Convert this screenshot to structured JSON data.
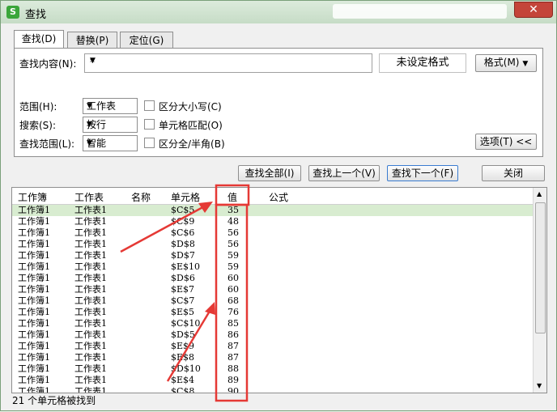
{
  "window": {
    "title": "查找",
    "app_icon": "S",
    "close_glyph": "✕"
  },
  "tabs": [
    "查找(D)",
    "替换(P)",
    "定位(G)"
  ],
  "find": {
    "label": "查找内容(N):",
    "value": "*",
    "format_state": "未设定格式",
    "format_button": "格式(M)"
  },
  "options": {
    "scope_label": "范围(H):",
    "scope_value": "工作表",
    "search_label": "搜索(S):",
    "search_value": "按行",
    "lookin_label": "查找范围(L):",
    "lookin_value": "智能",
    "match_case": "区分大小写(C)",
    "match_cell": "单元格匹配(O)",
    "match_width": "区分全/半角(B)",
    "options_button": "选项(T) <<"
  },
  "actions": {
    "find_all": "查找全部(I)",
    "find_prev": "查找上一个(V)",
    "find_next": "查找下一个(F)",
    "close": "关闭"
  },
  "results": {
    "columns": [
      "工作簿",
      "工作表",
      "名称",
      "单元格",
      "值",
      "公式"
    ],
    "rows": [
      [
        "工作簿1",
        "工作表1",
        "$C$5",
        "35"
      ],
      [
        "工作簿1",
        "工作表1",
        "$C$9",
        "48"
      ],
      [
        "工作簿1",
        "工作表1",
        "$C$6",
        "56"
      ],
      [
        "工作簿1",
        "工作表1",
        "$D$8",
        "56"
      ],
      [
        "工作簿1",
        "工作表1",
        "$D$7",
        "59"
      ],
      [
        "工作簿1",
        "工作表1",
        "$E$10",
        "59"
      ],
      [
        "工作簿1",
        "工作表1",
        "$D$6",
        "60"
      ],
      [
        "工作簿1",
        "工作表1",
        "$E$7",
        "60"
      ],
      [
        "工作簿1",
        "工作表1",
        "$C$7",
        "68"
      ],
      [
        "工作簿1",
        "工作表1",
        "$E$5",
        "76"
      ],
      [
        "工作簿1",
        "工作表1",
        "$C$10",
        "85"
      ],
      [
        "工作簿1",
        "工作表1",
        "$D$5",
        "86"
      ],
      [
        "工作簿1",
        "工作表1",
        "$E$9",
        "87"
      ],
      [
        "工作簿1",
        "工作表1",
        "$E$8",
        "87"
      ],
      [
        "工作簿1",
        "工作表1",
        "$D$10",
        "88"
      ],
      [
        "工作簿1",
        "工作表1",
        "$E$4",
        "89"
      ],
      [
        "工作簿1",
        "工作表1",
        "$C$8",
        "90"
      ]
    ]
  },
  "status": "21 个单元格被找到",
  "accent_color": "#e53935"
}
